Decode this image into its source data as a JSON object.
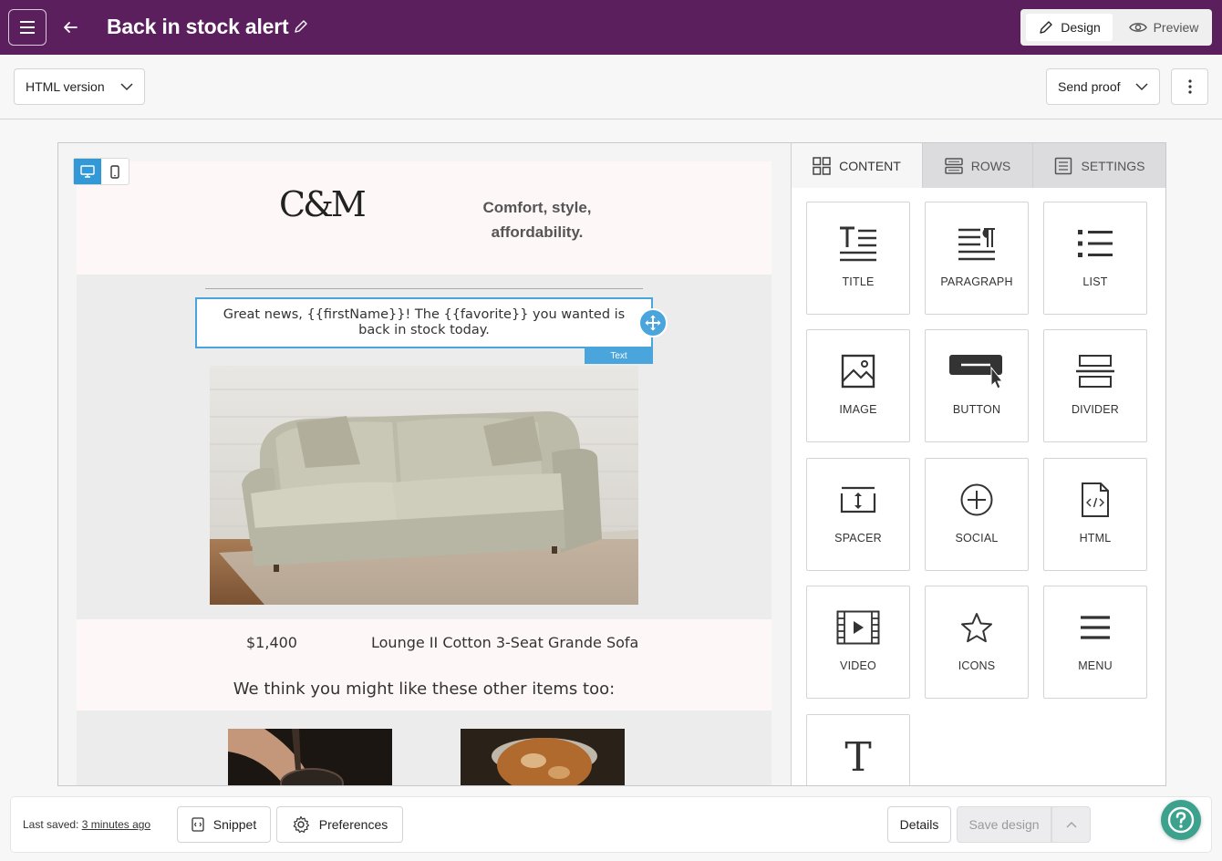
{
  "header": {
    "title": "Back in stock alert",
    "modes": {
      "design": "Design",
      "preview": "Preview",
      "active": "Design"
    }
  },
  "toolbar": {
    "version_select": "HTML version",
    "send_proof": "Send proof"
  },
  "canvas": {
    "device_modes": [
      "desktop",
      "mobile"
    ],
    "active_device": "desktop",
    "email": {
      "logo": "C&M",
      "tagline_line1": "Comfort, style,",
      "tagline_line2": "affordability.",
      "message": "Great news, {{firstName}}! The {{favorite}} you wanted is back in stock today.",
      "selected_block_tag": "Text",
      "product_price": "$1,400",
      "product_name": "Lounge II Cotton 3-Seat Grande Sofa",
      "recommendations_heading": "We think you might like these other items too:"
    }
  },
  "panel": {
    "tabs": [
      {
        "label": "CONTENT",
        "icon": "grid-icon",
        "active": true
      },
      {
        "label": "ROWS",
        "icon": "rows-icon",
        "active": false
      },
      {
        "label": "SETTINGS",
        "icon": "settings-doc-icon",
        "active": false
      }
    ],
    "blocks": [
      {
        "label": "TITLE",
        "icon": "title-icon"
      },
      {
        "label": "PARAGRAPH",
        "icon": "paragraph-icon"
      },
      {
        "label": "LIST",
        "icon": "list-icon"
      },
      {
        "label": "IMAGE",
        "icon": "image-icon"
      },
      {
        "label": "BUTTON",
        "icon": "button-icon"
      },
      {
        "label": "DIVIDER",
        "icon": "divider-icon"
      },
      {
        "label": "SPACER",
        "icon": "spacer-icon"
      },
      {
        "label": "SOCIAL",
        "icon": "social-icon"
      },
      {
        "label": "HTML",
        "icon": "html-icon"
      },
      {
        "label": "VIDEO",
        "icon": "video-icon"
      },
      {
        "label": "ICONS",
        "icon": "star-icon"
      },
      {
        "label": "MENU",
        "icon": "menu-icon"
      },
      {
        "label": "",
        "icon": "text-icon"
      }
    ]
  },
  "footer": {
    "last_saved_label": "Last saved:",
    "last_saved_value": "3 minutes ago",
    "snippet": "Snippet",
    "preferences": "Preferences",
    "details": "Details",
    "save_design": "Save design"
  },
  "colors": {
    "brand_header": "#5c1f5e",
    "selection_blue": "#4aa5dd",
    "help_green": "#3ca28e"
  }
}
